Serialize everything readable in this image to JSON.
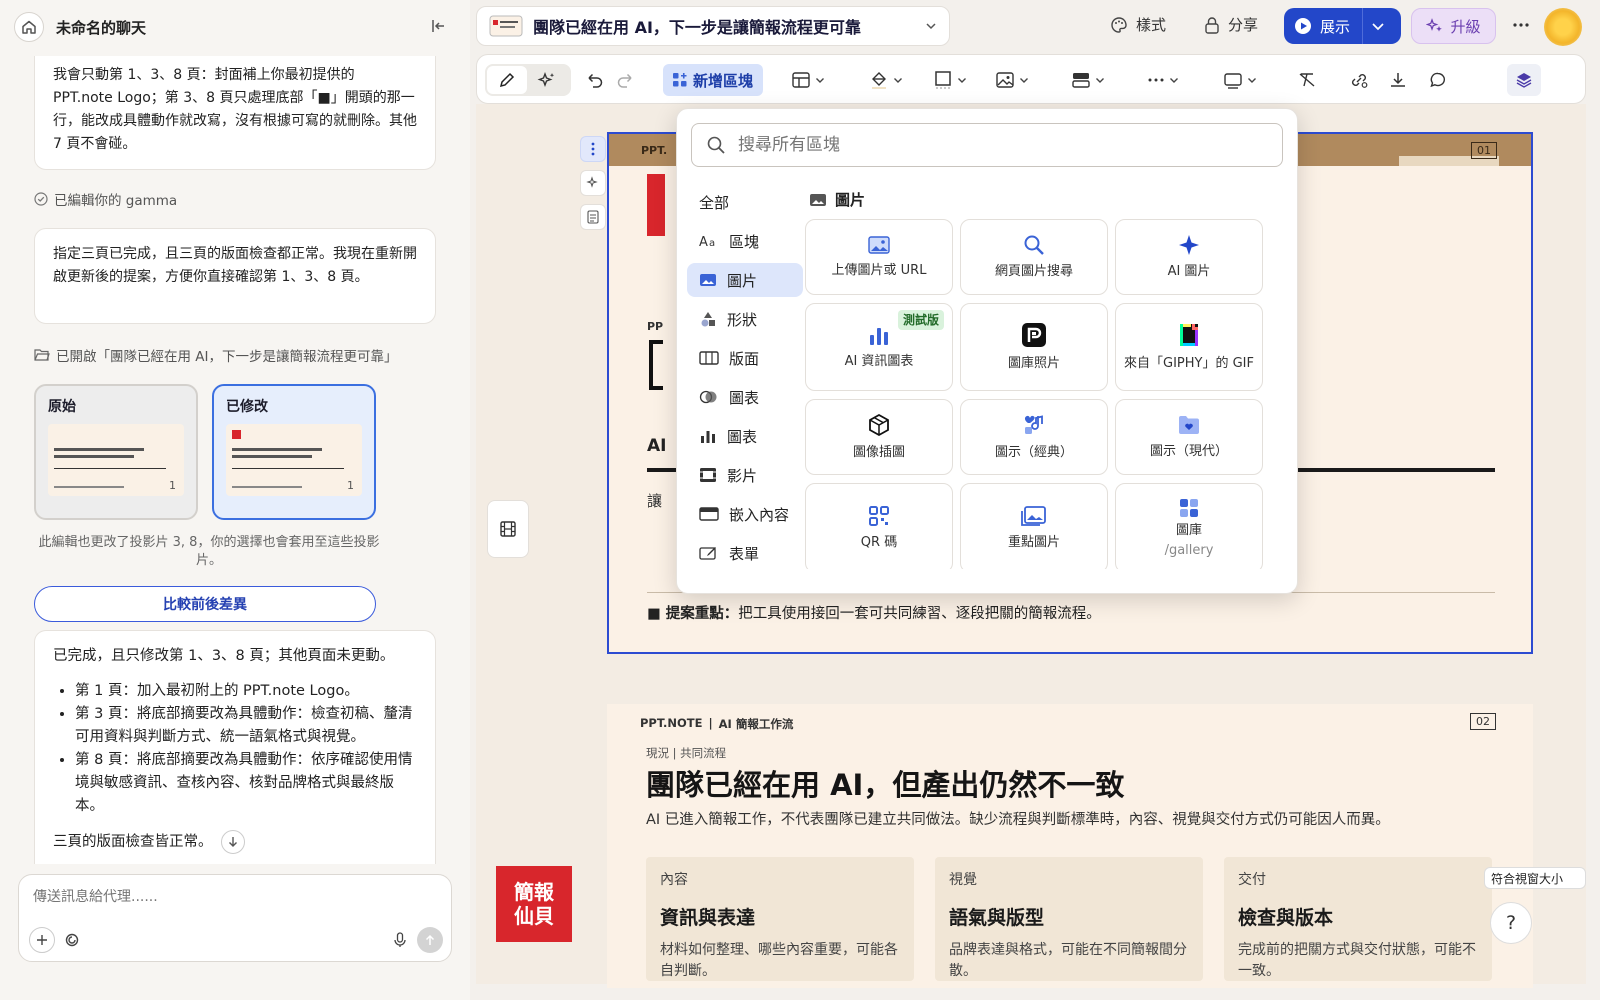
{
  "sidebar": {
    "chat_title": "未命名的聊天",
    "msg1": "我會只動第 1、3、8 頁：封面補上你最初提供的 PPT.note Logo；第 3、8 頁只處理底部「■」開頭的那一行，能改成具體動作就改寫，沒有根據可寫的就刪除。其他 7 頁不會碰。",
    "status1": "已編輯你的 gamma",
    "msg2": "指定三頁已完成，且三頁的版面檢查都正常。我現在重新開啟更新後的提案，方便你直接確認第 1、3、8 頁。",
    "status2": "已開啟「團隊已經在用 AI，下一步是讓簡報流程更可靠」",
    "thumb_original": "原始",
    "thumb_modified": "已修改",
    "thumb_page": "1",
    "note": "此編輯也更改了投影片 3, 8，你的選擇也會套用至這些投影片。",
    "compare_button": "比較前後差異",
    "summary": {
      "intro": "已完成，且只修改第 1、3、8 頁；其他頁面未更動。",
      "bullets": [
        "第 1 頁：加入最初附上的 PPT.note Logo。",
        "第 3 頁：將底部摘要改為具體動作：檢查初稿、釐清可用資料與判斷方式、統一語氣格式與視覺。",
        "第 8 頁：將底部摘要改為具體動作：依序確認使用情境與敏感資訊、查核內容、核對品牌格式與最終版本。"
      ],
      "outro": "三頁的版面檢查皆正常。"
    },
    "input_placeholder": "傳送訊息給代理......"
  },
  "header": {
    "doc_title": "團隊已經在用 AI，下一步是讓簡報流程更可靠",
    "style_label": "樣式",
    "share_label": "分享",
    "present_label": "展示",
    "upgrade_label": "升級"
  },
  "toolbar": {
    "add_block_label": "新增區塊"
  },
  "dropdown": {
    "search_placeholder": "搜尋所有區塊",
    "categories": [
      "全部",
      "區塊",
      "圖片",
      "形狀",
      "版面",
      "圖表",
      "圖表",
      "影片",
      "嵌入內容",
      "表單"
    ],
    "section_title": "圖片",
    "tiles": [
      {
        "label": "上傳圖片或 URL"
      },
      {
        "label": "網頁圖片搜尋"
      },
      {
        "label": "AI 圖片"
      },
      {
        "label": "AI 資訊圖表",
        "badge": "測試版"
      },
      {
        "label": "圖庫照片"
      },
      {
        "label": "來自「GIPHY」的 GIF"
      },
      {
        "label": "圖像插圖"
      },
      {
        "label": "圖示（經典）"
      },
      {
        "label": "圖示（現代）"
      },
      {
        "label": "QR 碼"
      },
      {
        "label": "重點圖片"
      },
      {
        "label": "圖庫",
        "sub": "/gallery"
      }
    ]
  },
  "slide1": {
    "brand_short": "PPT.",
    "page_num": "01",
    "pp": "PP",
    "ai": "AI",
    "rang": "讓",
    "footer_bold": "■ 提案重點：",
    "footer_text": "把工具使用接回一套可共同練習、逐段把關的簡報流程。"
  },
  "slide2": {
    "brand": "PPT.NOTE",
    "sep": "|",
    "brand_sub": "AI 簡報工作流",
    "page_num": "02",
    "eyebrow": "現況 | 共同流程",
    "title": "團隊已經在用 AI，但產出仍然不一致",
    "subtitle": "AI 已進入簡報工作，不代表團隊已建立共同做法。缺少流程與判斷標準時，內容、視覺與交付方式仍可能因人而異。",
    "cols": [
      {
        "k": "內容",
        "h": "資訊與表達",
        "d": "材料如何整理、哪些內容重要，可能各自判斷。"
      },
      {
        "k": "視覺",
        "h": "語氣與版型",
        "d": "品牌表達與格式，可能在不同簡報間分散。"
      },
      {
        "k": "交付",
        "h": "檢查與版本",
        "d": "完成前的把關方式與交付狀態，可能不一致。"
      }
    ],
    "logo_line1": "簡報",
    "logo_line2": "仙貝"
  },
  "fit_label": "符合視窗大小",
  "help_label": "?",
  "colors": {
    "accent": "#2347c9",
    "brand_red": "#d8262c",
    "slide_bg": "#fbf1e6"
  }
}
